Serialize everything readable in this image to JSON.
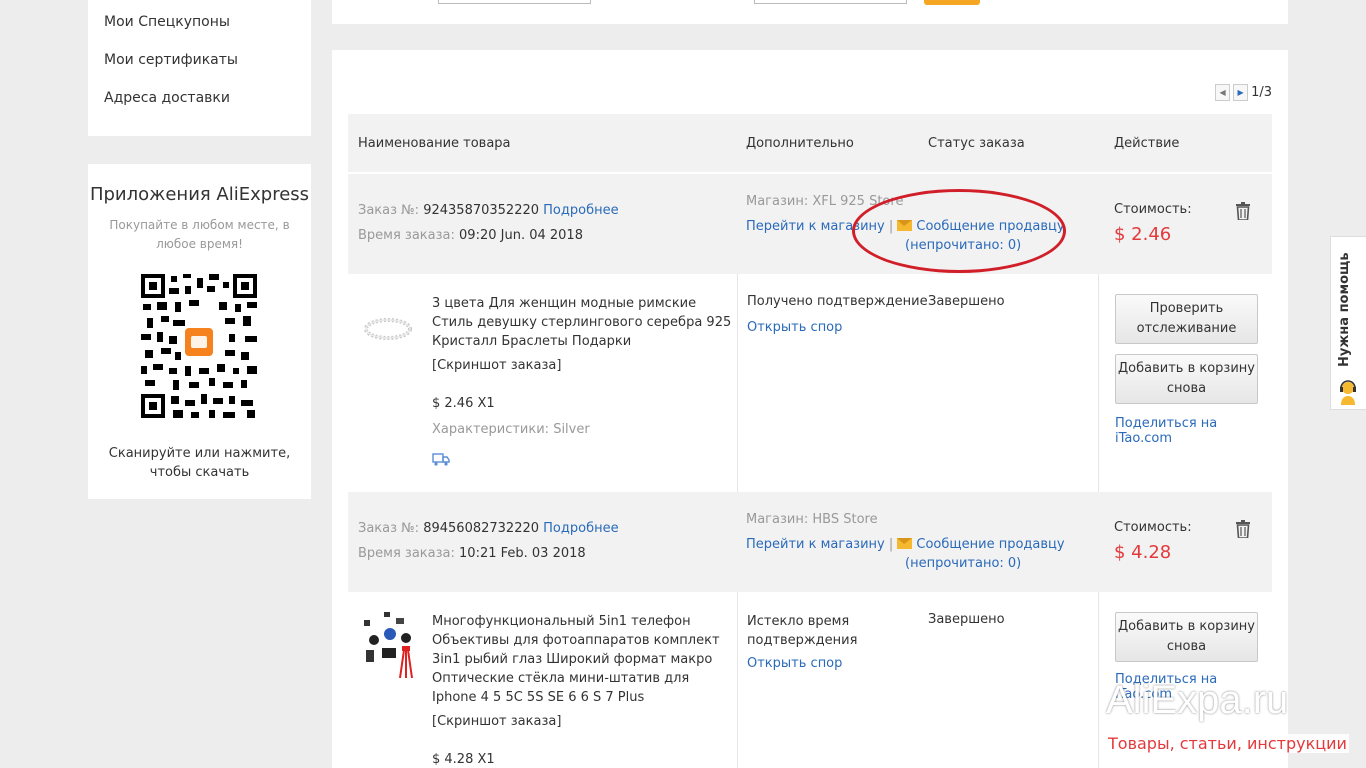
{
  "sidebar": {
    "links": [
      "Мои Спецкупоны",
      "Мои сертификаты",
      "Адреса доставки"
    ],
    "app": {
      "title": "Приложения AliExpress",
      "subtitle": "Покупайте в любом месте, в любое время!",
      "scan_text": "Сканируйте или нажмите, чтобы скачать"
    }
  },
  "pager": {
    "text": "1/3"
  },
  "table_header": {
    "product": "Наименование товара",
    "extra": "Дополнительно",
    "status": "Статус заказа",
    "action": "Действие"
  },
  "orders": [
    {
      "order_label": "Заказ №:",
      "order_no": "92435870352220",
      "details_link": "Подробнее",
      "time_label": "Время заказа:",
      "time": "09:20 Jun. 04 2018",
      "store_label": "Магазин:",
      "store": "XFL 925 Store",
      "goto_store": "Перейти к магазину",
      "message_seller": "Сообщение продавцу",
      "unread": "(непрочитано: 0)",
      "cost_label": "Стоимость:",
      "cost": "$ 2.46",
      "product_title": "3 цвета Для женщин модные римские Стиль девушку стерлингового серебра 925 Кристалл Браслеты Подарки",
      "screenshot": "[Скриншот заказа]",
      "price_qty": "$ 2.46 X1",
      "characteristics": "Характеристики: Silver",
      "extra_status": "Получено подтверждение",
      "dispute": "Открыть спор",
      "status": "Завершено",
      "buttons": [
        "Проверить отслеживание",
        "Добавить в корзину снова"
      ],
      "share": "Поделиться на iTao.com"
    },
    {
      "order_label": "Заказ №:",
      "order_no": "89456082732220",
      "details_link": "Подробнее",
      "time_label": "Время заказа:",
      "time": "10:21 Feb. 03 2018",
      "store_label": "Магазин:",
      "store": "HBS Store",
      "goto_store": "Перейти к магазину",
      "message_seller": "Сообщение продавцу",
      "unread": "(непрочитано: 0)",
      "cost_label": "Стоимость:",
      "cost": "$ 4.28",
      "product_title": "Многофункциональный 5in1 телефон Объективы для фотоаппаратов комплект 3in1 рыбий глаз Широкий формат макро Оптические стёкла мини-штатив для Iphone 4 5 5C 5S SE 6 6 S 7 Plus",
      "screenshot": "[Скриншот заказа]",
      "price_qty": "$ 4.28 X1",
      "extra_status": "Истекло время подтверждения",
      "dispute": "Открыть спор",
      "status": "Завершено",
      "buttons": [
        "Добавить в корзину снова"
      ],
      "share": "Поделиться на iTao.com"
    }
  ],
  "help_tab": "Нужна помощь",
  "watermark": {
    "logo": "AliExpa.ru",
    "sub": "Товары, статьи, инструкции"
  },
  "colors": {
    "accent": "#e4393c",
    "link": "#2a6aba",
    "highlight": "#d11f2a"
  }
}
